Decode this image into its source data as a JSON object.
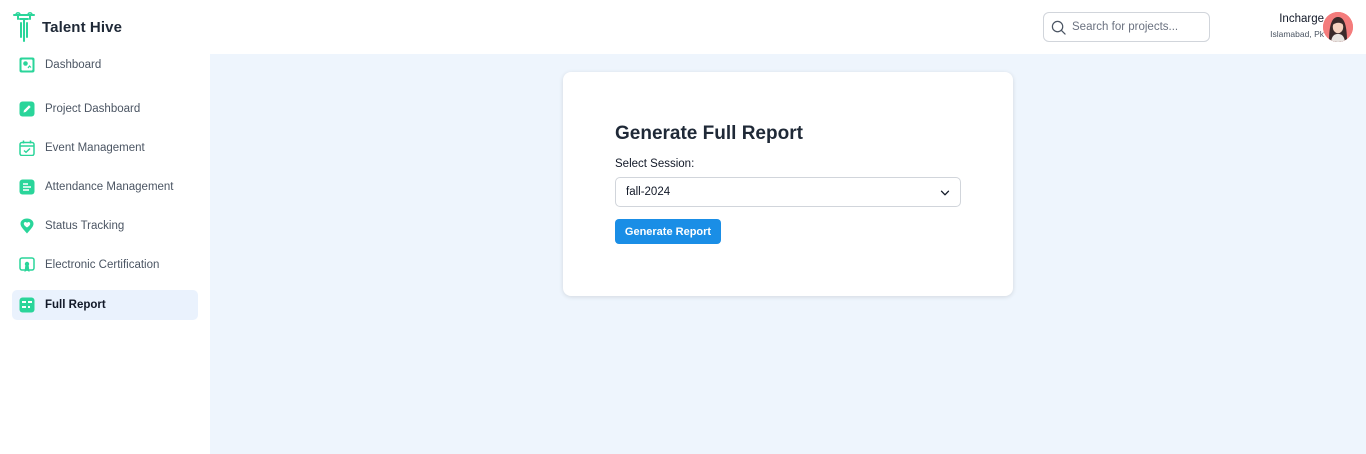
{
  "app": {
    "name": "Talent Hive",
    "accent_color": "#2ad59a",
    "primary_button_color": "#1a8ee6"
  },
  "search": {
    "placeholder": "Search for projects...",
    "value": ""
  },
  "user": {
    "name": "Incharge",
    "location": "Islamabad, Pk"
  },
  "sidebar": {
    "items": [
      {
        "label": "Dashboard",
        "icon": "chart-board-icon",
        "active": false
      },
      {
        "label": "Project Dashboard",
        "icon": "pencil-icon",
        "active": false
      },
      {
        "label": "Event Management",
        "icon": "calendar-check-icon",
        "active": false
      },
      {
        "label": "Attendance Management",
        "icon": "list-icon",
        "active": false
      },
      {
        "label": "Status Tracking",
        "icon": "location-pin-icon",
        "active": false
      },
      {
        "label": "Electronic Certification",
        "icon": "certificate-icon",
        "active": false
      },
      {
        "label": "Full Report",
        "icon": "report-icon",
        "active": true
      }
    ]
  },
  "report": {
    "title": "Generate Full Report",
    "session_label": "Select Session:",
    "session_value": "fall-2024",
    "button_label": "Generate Report"
  }
}
